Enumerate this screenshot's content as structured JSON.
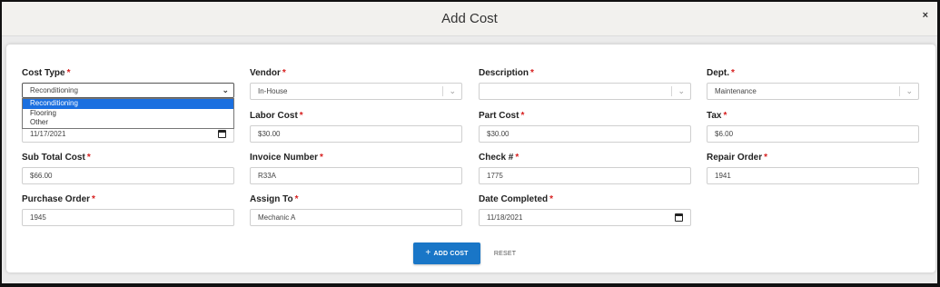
{
  "modal": {
    "title": "Add Cost",
    "close_label": "×"
  },
  "cost_type": {
    "label": "Cost Type",
    "value": "Reconditioning",
    "options": [
      "Reconditioning",
      "Flooring",
      "Other"
    ]
  },
  "vendor": {
    "label": "Vendor",
    "value": "In-House"
  },
  "description": {
    "label": "Description",
    "value": ""
  },
  "dept": {
    "label": "Dept.",
    "value": "Maintenance"
  },
  "date_field": {
    "value": "11/17/2021"
  },
  "labor_cost": {
    "label": "Labor Cost",
    "value": "$30.00"
  },
  "part_cost": {
    "label": "Part Cost",
    "value": "$30.00"
  },
  "tax": {
    "label": "Tax",
    "value": "$6.00"
  },
  "sub_total_cost": {
    "label": "Sub Total Cost",
    "value": "$66.00"
  },
  "invoice_number": {
    "label": "Invoice Number",
    "value": "R33A"
  },
  "check_number": {
    "label": "Check #",
    "value": "1775"
  },
  "repair_order": {
    "label": "Repair Order",
    "value": "1941"
  },
  "purchase_order": {
    "label": "Purchase Order",
    "value": "1945"
  },
  "assign_to": {
    "label": "Assign To",
    "value": "Mechanic A"
  },
  "date_completed": {
    "label": "Date Completed",
    "value": "11/18/2021"
  },
  "required_marker": "*",
  "actions": {
    "add_cost_label": "ADD COST",
    "add_cost_icon": "+",
    "reset_label": "RESET"
  },
  "colors": {
    "primary_button": "#1976c7",
    "required": "#d71e1e",
    "dropdown_highlight": "#1a6fe0"
  }
}
